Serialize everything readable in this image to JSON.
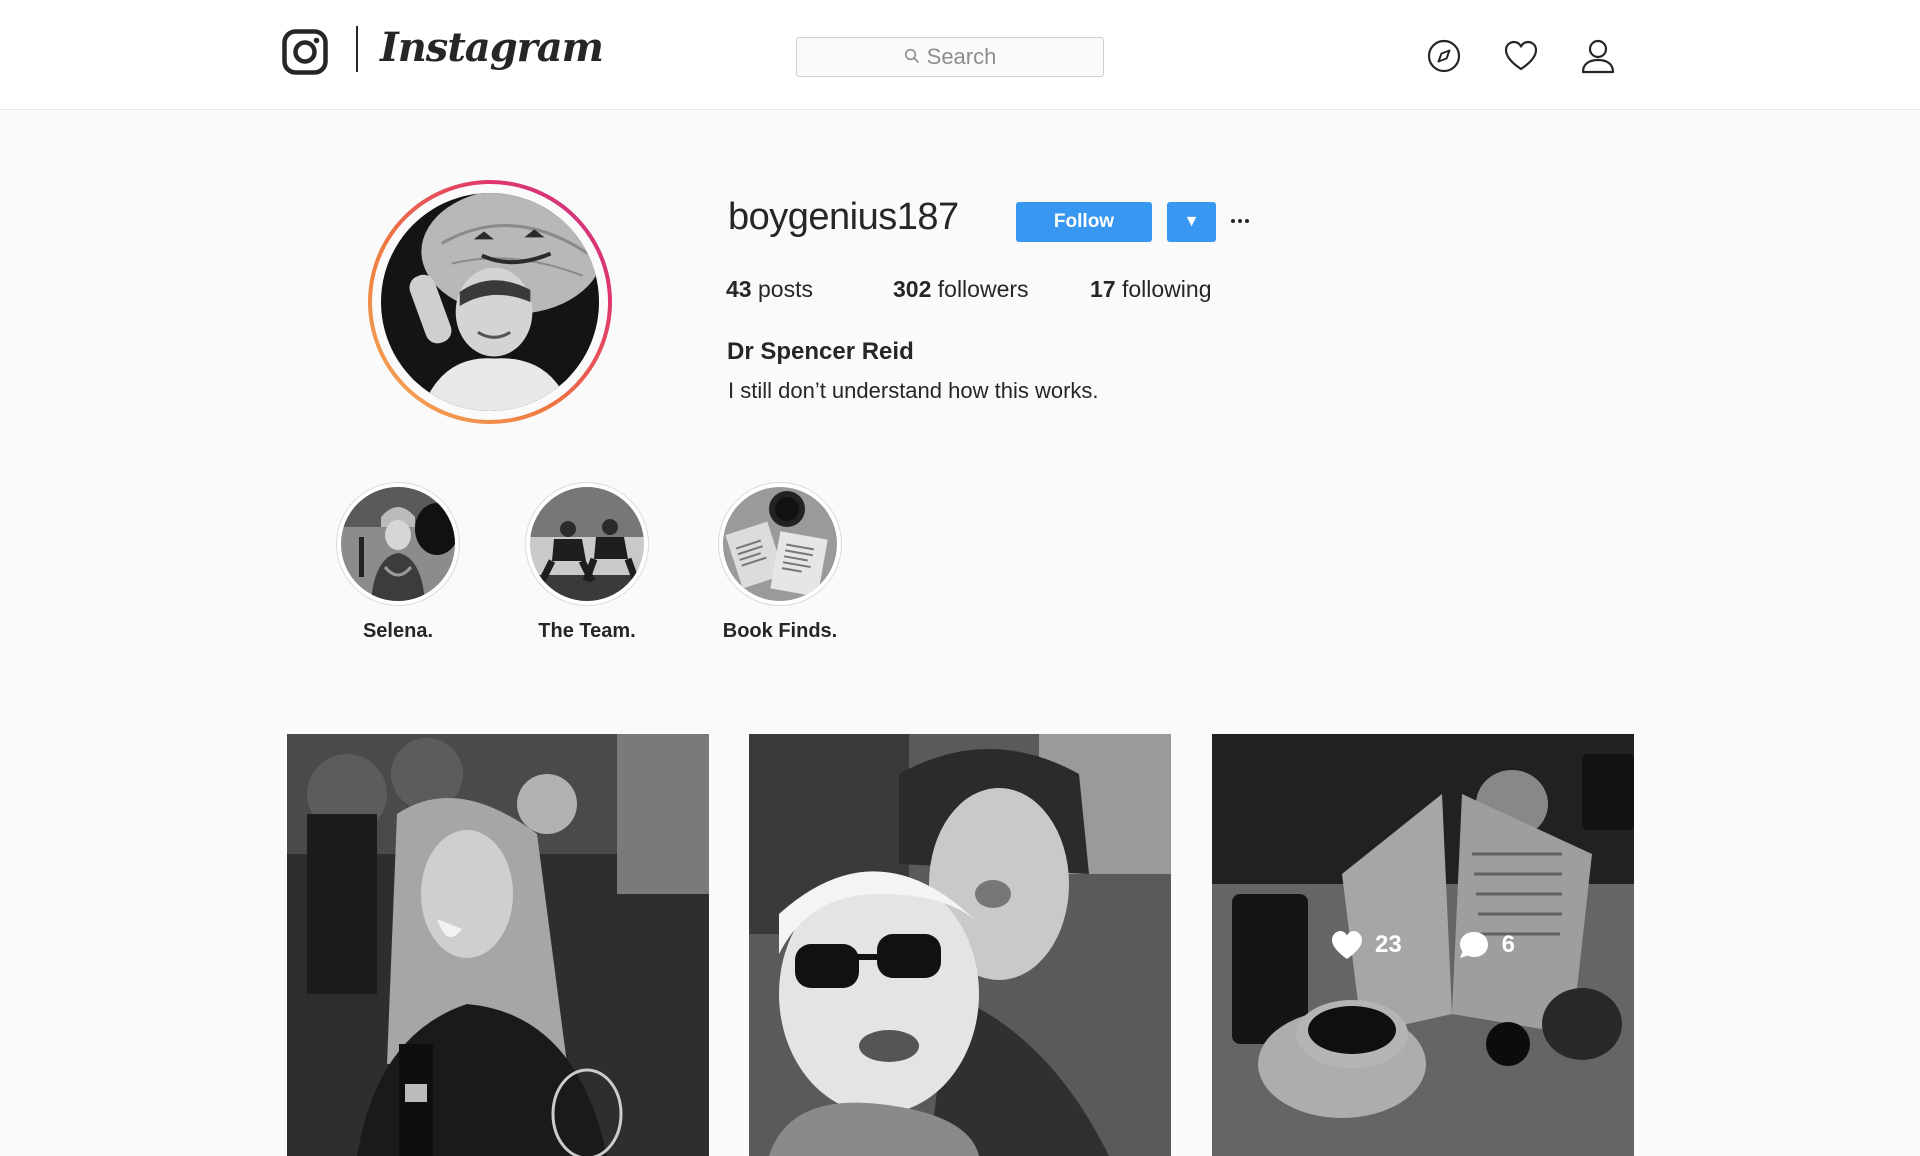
{
  "nav": {
    "brand": "Instagram",
    "search_placeholder": "Search",
    "icons": [
      "instagram-logo-icon",
      "compass-icon",
      "heart-icon",
      "profile-icon",
      "search-icon"
    ]
  },
  "profile": {
    "username": "boygenius187",
    "follow_label": "Follow",
    "dropdown_glyph": "▼",
    "posts_count": "43",
    "posts_label": "posts",
    "followers_count": "302",
    "followers_label": "followers",
    "following_count": "17",
    "following_label": "following",
    "full_name": "Dr Spencer Reid",
    "bio": "I still don’t understand how this works."
  },
  "highlights": [
    {
      "label": "Selena."
    },
    {
      "label": "The Team."
    },
    {
      "label": "Book Finds."
    }
  ],
  "posts": [
    {
      "kind": "photo"
    },
    {
      "kind": "photo"
    },
    {
      "kind": "photo",
      "hover": true,
      "likes": "23",
      "comments": "6"
    }
  ],
  "colors": {
    "accent": "#3897f0",
    "ring_gradient": [
      "#f4b05b",
      "#ee7840",
      "#e0366b",
      "#c4338f"
    ],
    "background": "#fafafa"
  }
}
